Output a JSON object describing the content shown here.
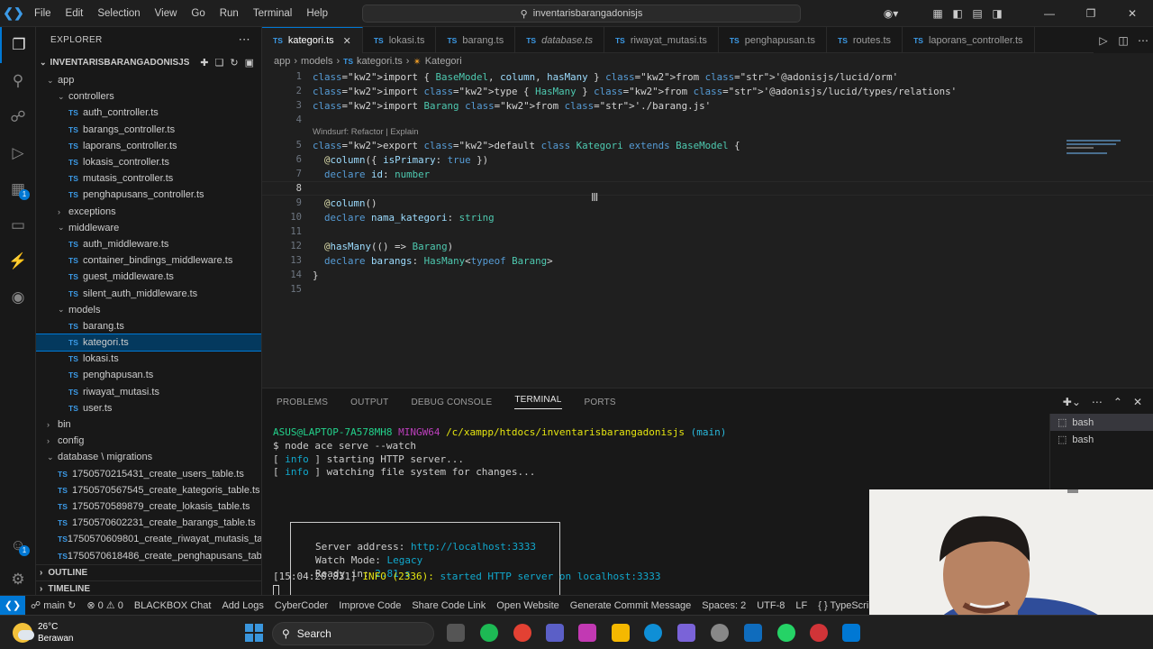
{
  "menu": [
    "File",
    "Edit",
    "Selection",
    "View",
    "Go",
    "Run",
    "Terminal",
    "Help"
  ],
  "command_center": "inventarisbarangadonisjs",
  "explorer": {
    "title": "EXPLORER",
    "project": "INVENTARISBARANGADONISJS",
    "tree": [
      {
        "label": "app",
        "type": "folder",
        "open": true,
        "indent": 0
      },
      {
        "label": "controllers",
        "type": "folder",
        "open": true,
        "indent": 1
      },
      {
        "label": "auth_controller.ts",
        "type": "ts",
        "indent": 2
      },
      {
        "label": "barangs_controller.ts",
        "type": "ts",
        "indent": 2
      },
      {
        "label": "laporans_controller.ts",
        "type": "ts",
        "indent": 2
      },
      {
        "label": "lokasis_controller.ts",
        "type": "ts",
        "indent": 2
      },
      {
        "label": "mutasis_controller.ts",
        "type": "ts",
        "indent": 2
      },
      {
        "label": "penghapusans_controller.ts",
        "type": "ts",
        "indent": 2
      },
      {
        "label": "exceptions",
        "type": "folder",
        "open": false,
        "indent": 1
      },
      {
        "label": "middleware",
        "type": "folder",
        "open": true,
        "indent": 1
      },
      {
        "label": "auth_middleware.ts",
        "type": "ts",
        "indent": 2
      },
      {
        "label": "container_bindings_middleware.ts",
        "type": "ts",
        "indent": 2
      },
      {
        "label": "guest_middleware.ts",
        "type": "ts",
        "indent": 2
      },
      {
        "label": "silent_auth_middleware.ts",
        "type": "ts",
        "indent": 2
      },
      {
        "label": "models",
        "type": "folder",
        "open": true,
        "indent": 1
      },
      {
        "label": "barang.ts",
        "type": "ts",
        "indent": 2
      },
      {
        "label": "kategori.ts",
        "type": "ts",
        "indent": 2,
        "selected": true
      },
      {
        "label": "lokasi.ts",
        "type": "ts",
        "indent": 2
      },
      {
        "label": "penghapusan.ts",
        "type": "ts",
        "indent": 2
      },
      {
        "label": "riwayat_mutasi.ts",
        "type": "ts",
        "indent": 2
      },
      {
        "label": "user.ts",
        "type": "ts",
        "indent": 2
      },
      {
        "label": "bin",
        "type": "folder",
        "open": false,
        "indent": 0
      },
      {
        "label": "config",
        "type": "folder",
        "open": false,
        "indent": 0
      },
      {
        "label": "database \\ migrations",
        "type": "folder",
        "open": true,
        "indent": 0
      },
      {
        "label": "1750570215431_create_users_table.ts",
        "type": "ts",
        "indent": 1
      },
      {
        "label": "1750570567545_create_kategoris_table.ts",
        "type": "ts",
        "indent": 1
      },
      {
        "label": "1750570589879_create_lokasis_table.ts",
        "type": "ts",
        "indent": 1
      },
      {
        "label": "1750570602231_create_barangs_table.ts",
        "type": "ts",
        "indent": 1
      },
      {
        "label": "1750570609801_create_riwayat_mutasis_ta...",
        "type": "ts",
        "indent": 1
      },
      {
        "label": "1750570618486_create_penghapusans_tabl...",
        "type": "ts",
        "indent": 1
      }
    ],
    "outline": "OUTLINE",
    "timeline": "TIMELINE"
  },
  "tabs": [
    {
      "label": "kategori.ts",
      "active": true,
      "italic": false
    },
    {
      "label": "lokasi.ts",
      "active": false,
      "italic": false
    },
    {
      "label": "barang.ts",
      "active": false,
      "italic": false
    },
    {
      "label": "database.ts",
      "active": false,
      "italic": true
    },
    {
      "label": "riwayat_mutasi.ts",
      "active": false,
      "italic": false
    },
    {
      "label": "penghapusan.ts",
      "active": false,
      "italic": false
    },
    {
      "label": "routes.ts",
      "active": false,
      "italic": false
    },
    {
      "label": "laporans_controller.ts",
      "active": false,
      "italic": false
    }
  ],
  "breadcrumb": [
    "app",
    "models",
    "kategori.ts",
    "Kategori"
  ],
  "codelens": "Windsurf: Refactor | Explain",
  "code_lines": [
    "import { BaseModel, column, hasMany } from '@adonisjs/lucid/orm'",
    "import type { HasMany } from '@adonisjs/lucid/types/relations'",
    "import Barang from './barang.js'",
    "",
    "export default class Kategori extends BaseModel {",
    "  @column({ isPrimary: true })",
    "  declare id: number",
    "",
    "  @column()",
    "  declare nama_kategori: string",
    "",
    "  @hasMany(() => Barang)",
    "  declare barangs: HasMany<typeof Barang>",
    "}",
    ""
  ],
  "panel": {
    "tabs": [
      "PROBLEMS",
      "OUTPUT",
      "DEBUG CONSOLE",
      "TERMINAL",
      "PORTS"
    ],
    "active_tab": "TERMINAL",
    "terminals": [
      "bash",
      "bash"
    ],
    "prompt_user": "ASUS@LAPTOP-7A578MH8",
    "prompt_env": "MINGW64",
    "prompt_path": "/c/xampp/htdocs/inventarisbarangadonisjs",
    "prompt_branch": "(main)",
    "command": "$ node ace serve --watch",
    "info_lines": [
      "starting HTTP server...",
      "watching file system for changes..."
    ],
    "info_tag": "info",
    "box": {
      "address_label": "Server address:",
      "address": "http://localhost:3333",
      "watch_label": "Watch Mode:",
      "watch": "Legacy",
      "ready_label": "Ready in:",
      "ready": "2.81 s"
    },
    "log_time": "[15:04:20.831]",
    "log_level": "INFO (2336):",
    "log_msg": "started HTTP server on localhost:3333"
  },
  "status": {
    "branch": "main",
    "errors": "0",
    "warnings": "0",
    "items": [
      "BLACKBOX Chat",
      "Add Logs",
      "CyberCoder",
      "Improve Code",
      "Share Code Link",
      "Open Website",
      "Generate Commit Message",
      "Spaces: 2",
      "UTF-8",
      "LF",
      "{ } TypeScript"
    ]
  },
  "taskbar": {
    "temp": "26°C",
    "weather": "Berawan",
    "search": "Search"
  },
  "colors": {
    "accent": "#0078d4",
    "ts_icon": "#3c9be8",
    "terminal_green": "#23d18b"
  }
}
